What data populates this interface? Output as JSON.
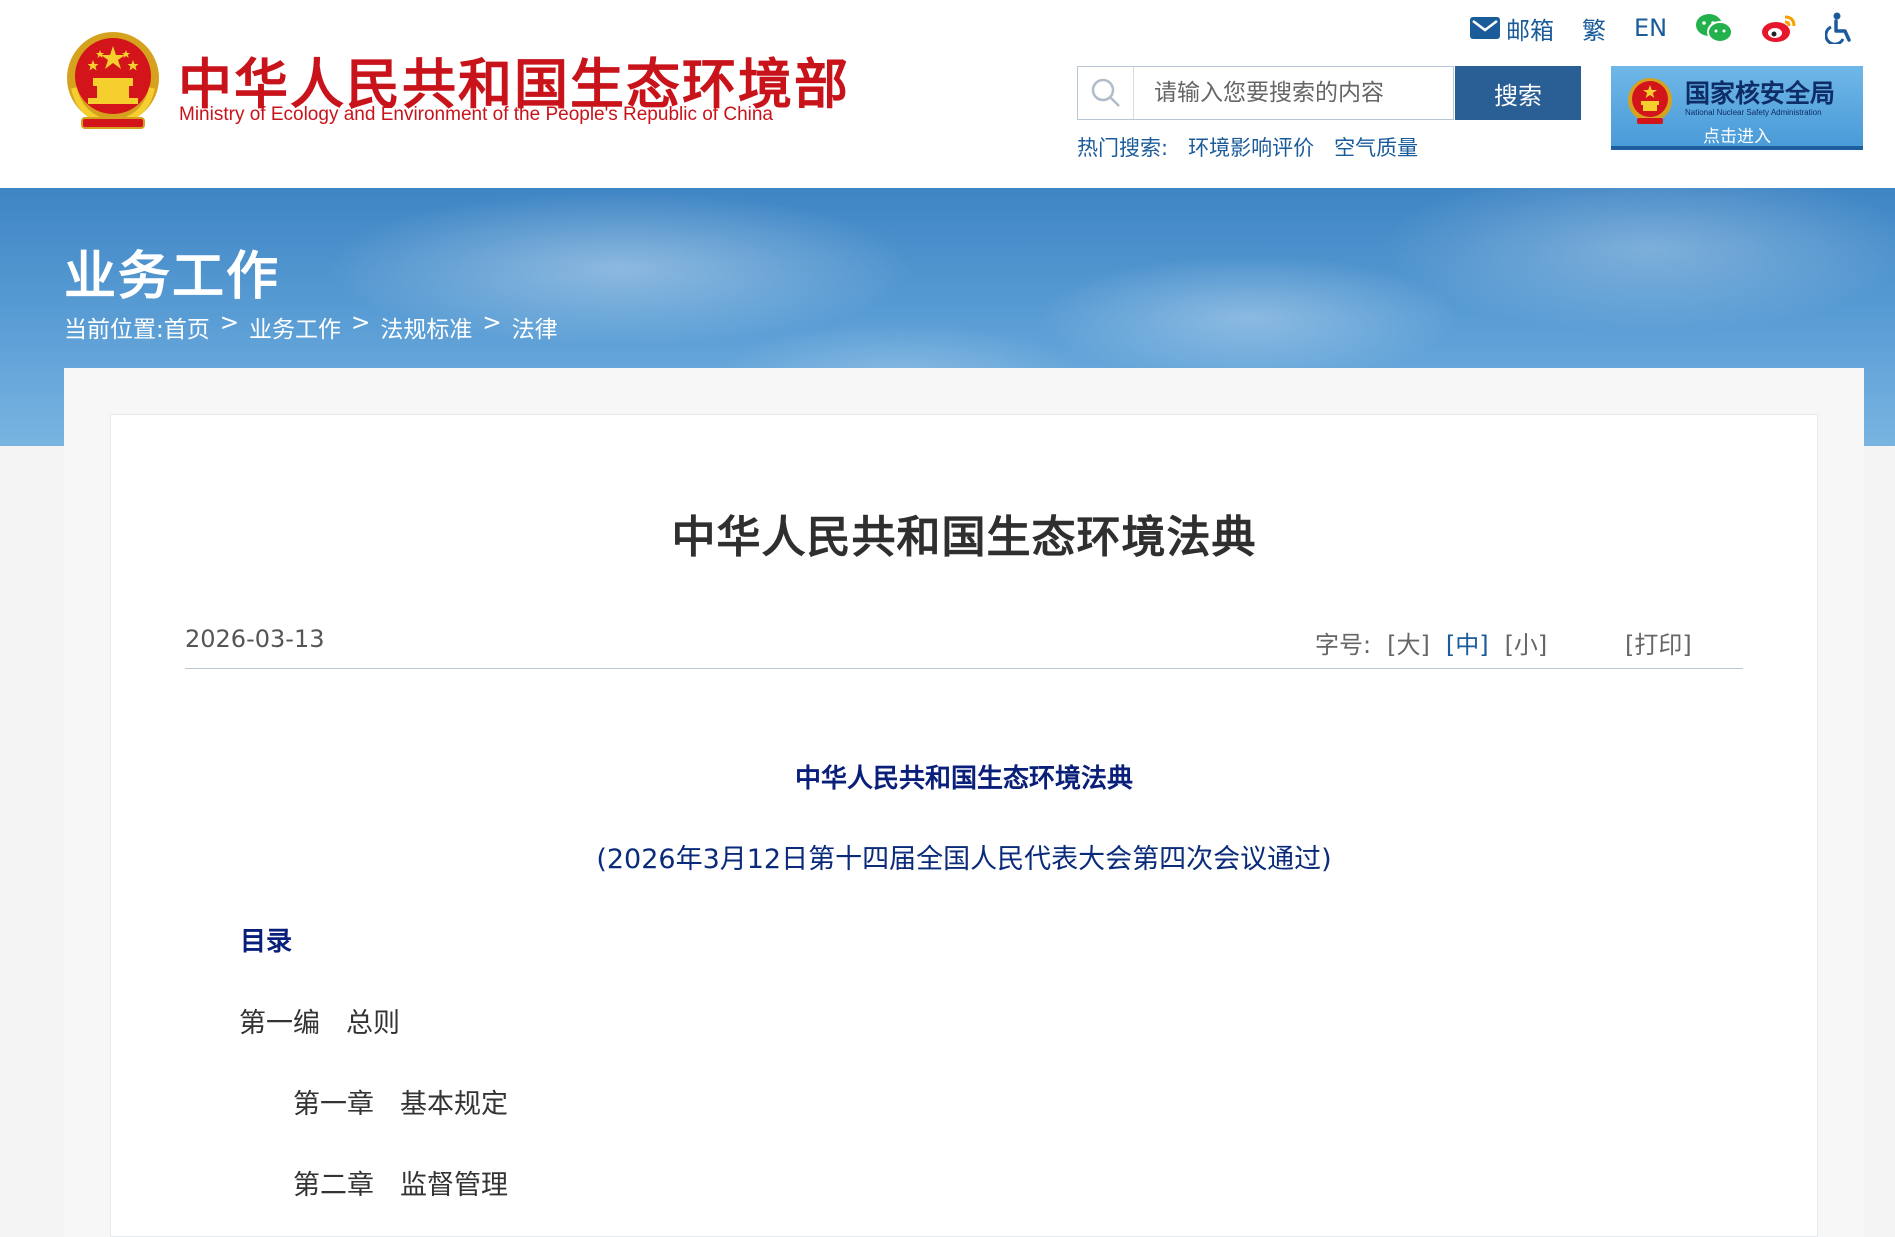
{
  "header": {
    "site_title": "中华人民共和国生态环境部",
    "site_subtitle": "Ministry of Ecology and Environment of the People's Republic of China",
    "top_links": {
      "mail": "邮箱",
      "traditional": "繁",
      "english": "EN"
    },
    "icons": [
      "mail-icon",
      "wechat-icon",
      "weibo-icon",
      "accessibility-icon"
    ],
    "search": {
      "placeholder": "请输入您要搜索的内容",
      "button_label": "搜索"
    },
    "hot_search": {
      "label": "热门搜索:",
      "items": [
        "环境影响评价",
        "空气质量"
      ]
    },
    "nnsa_banner": {
      "title": "国家核安全局",
      "english": "National Nuclear Safety Administration",
      "enter_label": "点击进入"
    }
  },
  "banner": {
    "section_title": "业务工作",
    "breadcrumb": {
      "prefix": "当前位置:",
      "items": [
        "首页",
        "业务工作",
        "法规标准",
        "法律"
      ],
      "separator": ">"
    }
  },
  "article": {
    "title": "中华人民共和国生态环境法典",
    "date": "2026-03-13",
    "font_size": {
      "label": "字号:",
      "large": "[大]",
      "medium": "[中]",
      "small": "[小]"
    },
    "print_label": "[打印]",
    "law_heading": "中华人民共和国生态环境法典",
    "law_note": "(2026年3月12日第十四届全国人民代表大会第四次会议通过)",
    "toc_title": "目录",
    "toc": [
      {
        "number": "第一编",
        "name": "总则"
      },
      {
        "number": "第一章",
        "name": "基本规定"
      },
      {
        "number": "第二章",
        "name": "监督管理"
      }
    ]
  },
  "colors": {
    "brand_red": "#c8131b",
    "link_blue": "#1a5b9a",
    "button_blue": "#2a5f95",
    "heading_navy": "#0a1f7a"
  }
}
